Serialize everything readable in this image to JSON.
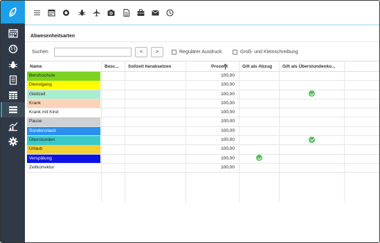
{
  "sidebar": {
    "logo_icon": "leaf-logo-icon",
    "items": [
      {
        "icon": "calendar-icon",
        "active": false
      },
      {
        "icon": "globe-icon",
        "active": false
      },
      {
        "icon": "bug-icon",
        "active": false
      },
      {
        "icon": "document-icon",
        "active": false
      },
      {
        "icon": "table-grid-icon",
        "active": false
      },
      {
        "icon": "list-icon",
        "active": true
      },
      {
        "icon": "chart-icon",
        "active": false
      },
      {
        "icon": "gear-icon",
        "active": false
      }
    ],
    "accent_color": "#1e9ee6",
    "background_color": "#2f3a46"
  },
  "toolbar": {
    "icons": [
      "menu-icon",
      "calendar-icon",
      "globe-icon",
      "bug-icon",
      "plane-icon",
      "camera-icon",
      "document-icon",
      "briefcase-icon",
      "mail-icon",
      "clock-icon"
    ]
  },
  "panel": {
    "title": "Abwesenheitsarten",
    "search_label": "Suchen",
    "search_value": "",
    "prev_label": "<",
    "next_label": ">",
    "regex_label": "Regulärer Ausdruck",
    "case_label": "Groß- und Kleinschreibung"
  },
  "table": {
    "columns": {
      "name": "Name",
      "desc": "Besc...",
      "reduce": "Sollzeit herabsetzen",
      "percent": "Prozent",
      "deduct": "Gilt als Abzug",
      "overtime": "Gilt als Überstundenko..."
    },
    "sort_icon": "sort-up-arrow-icon",
    "rows": [
      {
        "name": "Berufsschule",
        "color": "#7ed321",
        "percent": "100,00",
        "deduct": false,
        "overtime": false
      },
      {
        "name": "Dienstgang",
        "color": "#ffff00",
        "percent": "100,00",
        "deduct": false,
        "overtime": false
      },
      {
        "name": "Gleitzeit",
        "color": "#a8edcf",
        "percent": "100,00",
        "deduct": false,
        "overtime": true
      },
      {
        "name": "Krank",
        "color": "#fad3b8",
        "percent": "100,00",
        "deduct": false,
        "overtime": false
      },
      {
        "name": "Krank mit Kind",
        "color": "#ffffff",
        "percent": "100,00",
        "deduct": false,
        "overtime": false
      },
      {
        "name": "Pause",
        "color": "#d0d0d0",
        "percent": "100,00",
        "deduct": false,
        "overtime": false
      },
      {
        "name": "Sonderurlaub",
        "color": "#2a8ff0",
        "percent": "100,00",
        "deduct": false,
        "overtime": false
      },
      {
        "name": "Überstunden",
        "color": "#3cc9c9",
        "percent": "100,00",
        "deduct": false,
        "overtime": true
      },
      {
        "name": "Urlaub",
        "color": "#f5d033",
        "percent": "100,00",
        "deduct": false,
        "overtime": false
      },
      {
        "name": "Verspätung",
        "color": "#0a14e6",
        "percent": "100,00",
        "deduct": true,
        "overtime": false
      },
      {
        "name": "Zeitkorrektur",
        "color": "#ffffff",
        "percent": "100,00",
        "deduct": false,
        "overtime": false
      }
    ]
  }
}
